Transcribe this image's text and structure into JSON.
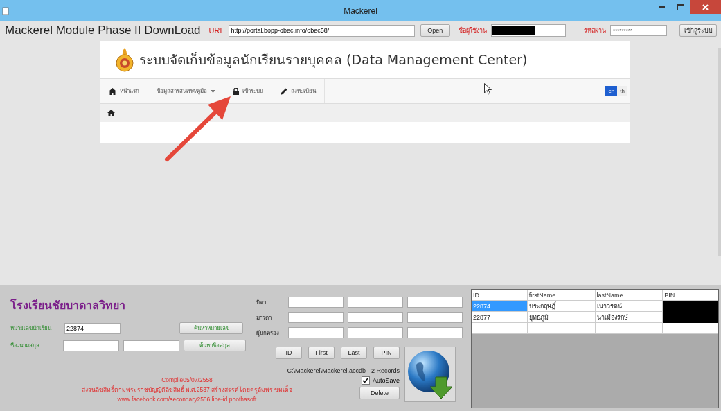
{
  "window": {
    "title": "Mackerel"
  },
  "toolbar": {
    "app_title": "Mackerel Module Phase II DownLoad",
    "url_label": "URL",
    "url": "http://portal.bopp-obec.info/obec58/",
    "open_button": "Open",
    "username_label": "ชื่อผู้ใช้งาน",
    "username_redacted": true,
    "password_label": "รหัสผ่าน",
    "password_value": "*********",
    "login_button": "เข้าสู่ระบบ"
  },
  "browser": {
    "site_title": "ระบบจัดเก็บข้อมูลนักเรียนรายบุคคล (Data Management Center)",
    "nav": [
      {
        "label": "หน้าแรก",
        "kind": "home",
        "dropdown": false
      },
      {
        "label": "ข้อมูลสารสนเทศ/คู่มือ",
        "kind": "menu",
        "dropdown": true
      },
      {
        "label": "เข้าระบบ",
        "kind": "login",
        "dropdown": false
      },
      {
        "label": "ลงทะเบียน",
        "kind": "register",
        "dropdown": false
      }
    ],
    "languages": [
      {
        "label": "en",
        "selected": true
      },
      {
        "label": "th",
        "selected": false
      }
    ]
  },
  "form": {
    "school": "โรงเรียนชัยบาดาลวิทยา",
    "student_id_label": "หมายเลขนักเรียน",
    "student_id_value": "22874",
    "name_label": "ชื่อ-นามสกุล",
    "search_id_button": "ค้นหาหมายเลข",
    "search_name_button": "ค้นหาชื่อสกุล",
    "parent_labels": [
      "บิดา",
      "มารดา",
      "ผู้ปกครอง"
    ],
    "sort_buttons": [
      "ID",
      "First",
      "Last",
      "PIN"
    ],
    "db_path": "C:\\Mackerel\\Mackerel.accdb",
    "record_count": "2 Records",
    "autosave": {
      "label": "AutoSave",
      "checked": true
    },
    "delete_button": "Delete",
    "credits": [
      "Compile05/07/2558",
      "สงวนลิขสิทธิ์ตามพระราชบัญญัติลิขสิทธิ์ พ.ศ.2537 สร้างสรรค์โดยครูอัมพร ขมเด็จ",
      "www.facebook.com/secondary2556 line-id phothasoft"
    ]
  },
  "grid": {
    "columns": [
      "ID",
      "firstName",
      "lastName",
      "PIN"
    ],
    "pin_redacted": true,
    "rows": [
      {
        "cells": [
          "22874",
          "ประกฤษฎิ์",
          "เนาวรัตน์"
        ],
        "selected": true
      },
      {
        "cells": [
          "22877",
          "ยุทธภูมิ",
          "นาเมืองรักษ์"
        ],
        "selected": false
      }
    ]
  }
}
